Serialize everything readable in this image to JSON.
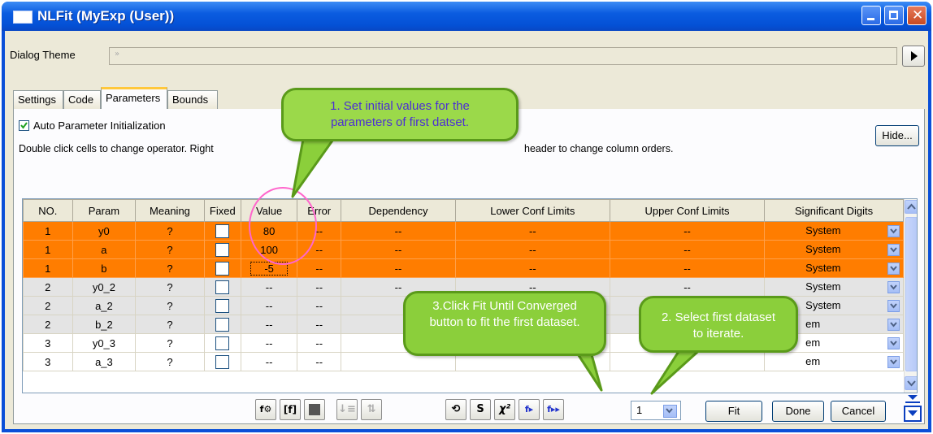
{
  "window": {
    "title": "NLFit (MyExp (User))"
  },
  "theme": {
    "label": "Dialog Theme",
    "value": "»"
  },
  "tabs": [
    {
      "label": "Settings"
    },
    {
      "label": "Code"
    },
    {
      "label": "Parameters"
    },
    {
      "label": "Bounds"
    }
  ],
  "auto_init": {
    "label": "Auto Parameter Initialization",
    "checked": true
  },
  "hint": "Double click cells to change operator. Right",
  "hint_tail": "header to change column orders.",
  "hide_button": "Hide...",
  "grid": {
    "headers": [
      "NO.",
      "Param",
      "Meaning",
      "Fixed",
      "Value",
      "Error",
      "Dependency",
      "Lower Conf Limits",
      "Upper Conf Limits",
      "Significant Digits"
    ],
    "rows": [
      {
        "no": "1",
        "param": "y0",
        "meaning": "?",
        "value": "80",
        "error": "--",
        "dep": "--",
        "lower": "--",
        "upper": "--",
        "sig": "System",
        "style": "orange"
      },
      {
        "no": "1",
        "param": "a",
        "meaning": "?",
        "value": "100",
        "error": "--",
        "dep": "--",
        "lower": "--",
        "upper": "--",
        "sig": "System",
        "style": "orange"
      },
      {
        "no": "1",
        "param": "b",
        "meaning": "?",
        "value": "-5",
        "error": "--",
        "dep": "--",
        "lower": "--",
        "upper": "--",
        "sig": "System",
        "style": "orange"
      },
      {
        "no": "2",
        "param": "y0_2",
        "meaning": "?",
        "value": "--",
        "error": "--",
        "dep": "--",
        "lower": "--",
        "upper": "--",
        "sig": "System",
        "style": "gray"
      },
      {
        "no": "2",
        "param": "a_2",
        "meaning": "?",
        "value": "--",
        "error": "--",
        "dep": "",
        "lower": "",
        "upper": "--",
        "sig": "System",
        "style": "gray"
      },
      {
        "no": "2",
        "param": "b_2",
        "meaning": "?",
        "value": "--",
        "error": "--",
        "dep": "",
        "lower": "",
        "upper": "",
        "sig": "em",
        "style": "gray"
      },
      {
        "no": "3",
        "param": "y0_3",
        "meaning": "?",
        "value": "--",
        "error": "--",
        "dep": "",
        "lower": "",
        "upper": "",
        "sig": "em",
        "style": "white"
      },
      {
        "no": "3",
        "param": "a_3",
        "meaning": "?",
        "value": "--",
        "error": "--",
        "dep": "",
        "lower": "",
        "upper": "",
        "sig": "em",
        "style": "white"
      }
    ]
  },
  "dataset_combo": {
    "value": "1"
  },
  "buttons": {
    "fit": "Fit",
    "done": "Done",
    "cancel": "Cancel"
  },
  "callouts": {
    "one": "1. Set initial values for the parameters of first datset.",
    "two": "2. Select first dataset to iterate.",
    "three": "3.Click Fit Until Converged button to fit the first dataset."
  },
  "colors": {
    "active_rows": "#ff7d00",
    "callout": "#8bcf3b",
    "highlight_ring": "#ff66cc"
  }
}
